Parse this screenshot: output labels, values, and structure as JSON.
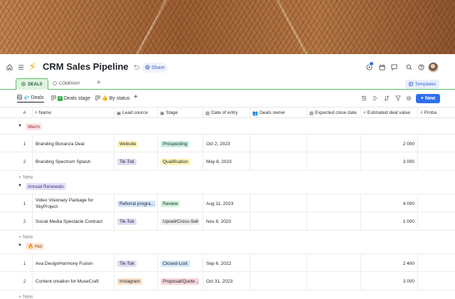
{
  "page": {
    "title": "CRM Sales Pipeline",
    "share_label": "Share",
    "more_label": "···",
    "tabs": [
      {
        "label": "DEALS",
        "active": true
      },
      {
        "label": "COMPANY",
        "active": false
      }
    ],
    "templates_label": "Templates",
    "views": [
      {
        "label": "Deals",
        "active": true
      },
      {
        "label": "Deals stage",
        "active": false
      },
      {
        "label": "By status",
        "active": false
      }
    ],
    "new_label": "New",
    "add_new_label": "New"
  },
  "columns": [
    "#",
    "Name",
    "Lead source",
    "Stage",
    "Date of entry",
    "Deals owner",
    "Expected close date",
    "Estimated deal value",
    "Proba"
  ],
  "groups": [
    {
      "label": "Warm",
      "emoji": "",
      "label_bg": "#fde4e6",
      "label_color": "#8a2b35",
      "rows": [
        {
          "idx": "1",
          "name": "Branding Bonanza Deal",
          "lead": "Website",
          "lead_bg": "#fdf3b7",
          "stage": "Prospecting",
          "stage_bg": "#c9f0e3",
          "date": "Oct 2, 2023",
          "value": "2 000"
        },
        {
          "idx": "2",
          "name": "Branding Spectrum Splash",
          "lead": "Tik-Tok",
          "lead_bg": "#e0dcf7",
          "stage": "Qualification",
          "stage_bg": "#fdf3b7",
          "date": "May 8, 2023",
          "value": "3 000"
        }
      ]
    },
    {
      "label": "Annual Renewals",
      "emoji": "",
      "label_bg": "#e5e0f8",
      "label_color": "#3e3380",
      "rows": [
        {
          "idx": "1",
          "name": "Video Visionary Package for SkyProject",
          "lead": "Referral progra...",
          "lead_bg": "#d6e6fb",
          "stage": "Review",
          "stage_bg": "#d3f3d8",
          "date": "Aug 11, 2023",
          "value": "4 000"
        },
        {
          "idx": "2",
          "name": "Social Media Spectacle Contract",
          "lead": "Tik-Tok",
          "lead_bg": "#e0dcf7",
          "stage": "Upsell/Cross-Sell",
          "stage_bg": "#ececec",
          "date": "Nov 8, 2023",
          "value": "1 000"
        }
      ]
    },
    {
      "label": "Hot",
      "emoji": "🔥",
      "label_bg": "#fde8d8",
      "label_color": "#8a4410",
      "rows": [
        {
          "idx": "1",
          "name": "Ava DesignHarmony Fusion",
          "lead": "Tik-Tok",
          "lead_bg": "#e0dcf7",
          "stage": "Closed-Lost",
          "stage_bg": "#d6e6fb",
          "date": "Sep 6, 2022",
          "value": "2 400"
        },
        {
          "idx": "2",
          "name": "Content creation for MuseCraft",
          "lead": "Instagram",
          "lead_bg": "#fde0c9",
          "stage": "Proposal/Quote ...",
          "stage_bg": "#f9d4d8",
          "date": "Oct 31, 2023",
          "value": "3 000"
        }
      ]
    }
  ],
  "icons": {
    "home": "home-icon",
    "menu": "menu-icon",
    "undo": "undo-icon",
    "globe": "globe-icon",
    "bell": "bell-icon",
    "calendar": "calendar-icon",
    "chat": "chat-icon",
    "search": "search-icon",
    "help": "help-icon"
  },
  "colors": {
    "accent": "#2f6fef",
    "deals_tab": "#5bc06a",
    "bolt": "#f2b200"
  }
}
